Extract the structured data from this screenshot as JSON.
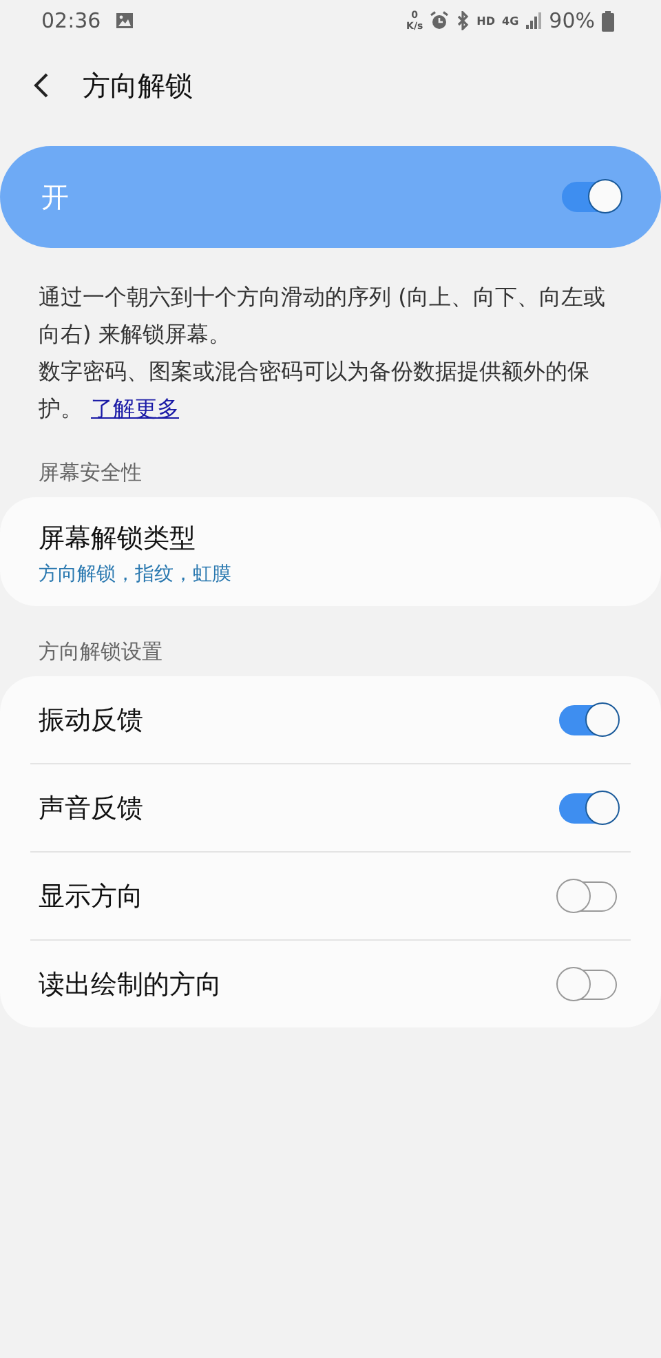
{
  "status_bar": {
    "time": "02:36",
    "net_speed_value": "0",
    "net_speed_unit": "K/s",
    "hd": "HD",
    "network": "4G",
    "battery": "90%"
  },
  "header": {
    "title": "方向解锁"
  },
  "master_switch": {
    "label": "开",
    "on": true
  },
  "description": {
    "paragraphs": [
      "通过一个朝六到十个方向滑动的序列 (向上、向下、向左或向右) 来解锁屏幕。",
      "数字密码、图案或混合密码可以为备份数据提供额外的保护。"
    ],
    "link": "了解更多"
  },
  "sections": [
    {
      "title": "屏幕安全性",
      "items": [
        {
          "kind": "link",
          "title": "屏幕解锁类型",
          "subtitle": "方向解锁，指纹，虹膜"
        }
      ]
    },
    {
      "title": "方向解锁设置",
      "items": [
        {
          "kind": "switch",
          "title": "振动反馈",
          "on": true
        },
        {
          "kind": "switch",
          "title": "声音反馈",
          "on": true
        },
        {
          "kind": "switch",
          "title": "显示方向",
          "on": false
        },
        {
          "kind": "switch",
          "title": "读出绘制的方向",
          "on": false
        }
      ]
    }
  ]
}
